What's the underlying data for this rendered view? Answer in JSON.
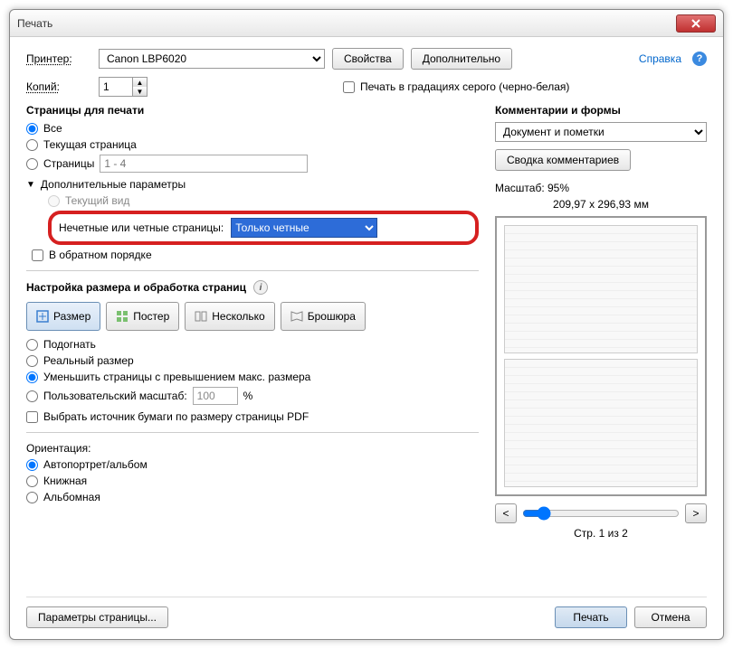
{
  "window": {
    "title": "Печать"
  },
  "header": {
    "printer_label": "Принтер:",
    "printer_value": "Canon LBP6020",
    "properties_btn": "Свойства",
    "advanced_btn": "Дополнительно",
    "help_link": "Справка",
    "copies_label": "Копий:",
    "copies_value": "1",
    "grayscale_label": "Печать в градациях серого (черно-белая)"
  },
  "pages": {
    "title": "Страницы для печати",
    "all": "Все",
    "current": "Текущая страница",
    "range_label": "Страницы",
    "range_placeholder": "1 - 4",
    "more_params": "Дополнительные параметры",
    "current_view": "Текущий вид",
    "odd_even_label": "Нечетные или четные страницы:",
    "odd_even_value": "Только четные",
    "reverse": "В обратном порядке"
  },
  "sizing": {
    "title": "Настройка размера и обработка страниц",
    "tabs": {
      "size": "Размер",
      "poster": "Постер",
      "multiple": "Несколько",
      "booklet": "Брошюра"
    },
    "fit": "Подогнать",
    "actual": "Реальный размер",
    "shrink": "Уменьшить страницы с превышением макс. размера",
    "custom_label": "Пользовательский масштаб:",
    "custom_value": "100",
    "custom_pct": "%",
    "paper_source": "Выбрать источник бумаги по размеру страницы PDF"
  },
  "orientation": {
    "title": "Ориентация:",
    "auto": "Автопортрет/альбом",
    "portrait": "Книжная",
    "landscape": "Альбомная"
  },
  "comments": {
    "title": "Комментарии и формы",
    "value": "Документ и пометки",
    "summary_btn": "Сводка комментариев"
  },
  "preview": {
    "scale_label": "Масштаб:  95%",
    "dims": "209,97 x 296,93 мм",
    "page_of": "Стр. 1 из 2",
    "prev": "<",
    "next": ">"
  },
  "footer": {
    "page_setup": "Параметры страницы...",
    "print": "Печать",
    "cancel": "Отмена"
  }
}
